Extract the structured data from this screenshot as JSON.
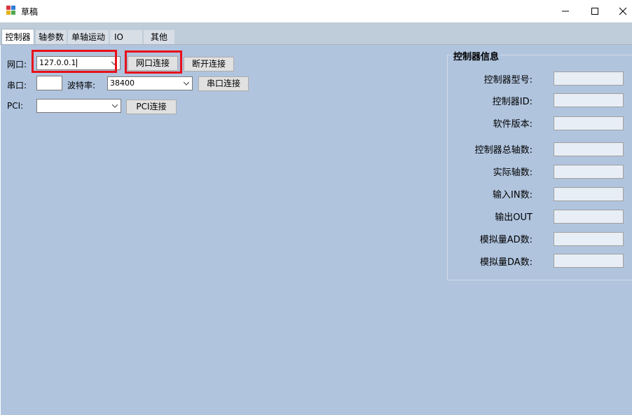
{
  "window": {
    "title": "草稿"
  },
  "tabs": [
    {
      "label": "控制器"
    },
    {
      "label": "轴参数"
    },
    {
      "label": "单轴运动"
    },
    {
      "label": "IO"
    },
    {
      "label": "其他"
    }
  ],
  "network": {
    "label": "网口:",
    "ip_value": "127.0.0.1",
    "connect_label": "网口连接",
    "disconnect_label": "断开连接"
  },
  "serial": {
    "label": "串口:",
    "port_value": "",
    "baud_label": "波特率:",
    "baud_value": "38400",
    "connect_label": "串口连接"
  },
  "pci": {
    "label": "PCI:",
    "value": "",
    "connect_label": "PCI连接"
  },
  "controller_info": {
    "title": "控制器信息",
    "fields": [
      {
        "label": "控制器型号:",
        "value": ""
      },
      {
        "label": "控制器ID:",
        "value": ""
      },
      {
        "label": "软件版本:",
        "value": ""
      },
      {
        "label": "控制器总轴数:",
        "value": ""
      },
      {
        "label": "实际轴数:",
        "value": ""
      },
      {
        "label": "输入IN数:",
        "value": ""
      },
      {
        "label": "输出OUT",
        "value": ""
      },
      {
        "label": "模拟量AD数:",
        "value": ""
      },
      {
        "label": "模拟量DA数:",
        "value": ""
      }
    ]
  },
  "colors": {
    "panel_bg": "#b0c4de",
    "highlight": "#e8101a",
    "tabbar_bg": "#bfccd9"
  }
}
